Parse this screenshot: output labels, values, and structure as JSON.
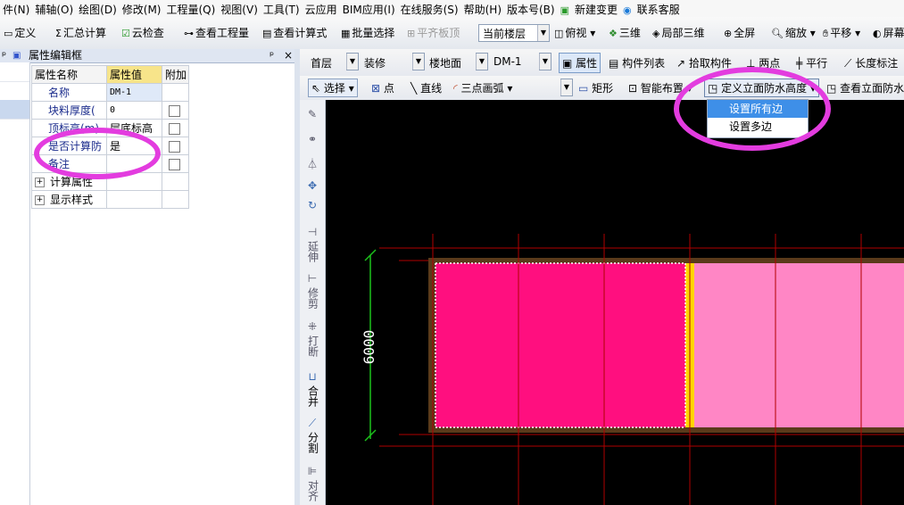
{
  "menubar": [
    "件(N)",
    "辅轴(O)",
    "绘图(D)",
    "修改(M)",
    "工程量(Q)",
    "视图(V)",
    "工具(T)",
    "云应用",
    "BIM应用(I)",
    "在线服务(S)",
    "帮助(H)",
    "版本号(B)",
    "新建变更",
    "联系客服"
  ],
  "toolbar1": {
    "define": "定义",
    "sum_calc": "汇总计算",
    "cloud_check": "云检查",
    "view_quantity": "查看工程量",
    "view_formula": "查看计算式",
    "batch_select": "批量选择",
    "align_slab": "平齐板顶",
    "floor_combo": "当前楼层",
    "top_view": "俯视",
    "three_d": "三维",
    "local_3d": "局部三维",
    "fullscreen": "全屏",
    "zoom": "缩放",
    "pan": "平移",
    "screen": "屏幕"
  },
  "panel": {
    "title": "属性编辑框",
    "pin": "ᵖ",
    "close": "×"
  },
  "prop_table": {
    "headers": [
      "属性名称",
      "属性值",
      "附加"
    ],
    "rows": [
      {
        "name": "名称",
        "value": "DM-1"
      },
      {
        "name": "块料厚度(",
        "value": "0"
      },
      {
        "name": "顶标高(m)",
        "value": "层底标高"
      },
      {
        "name": "是否计算防",
        "value": "是"
      },
      {
        "name": "备注",
        "value": ""
      }
    ],
    "groups": [
      "计算属性",
      "显示样式"
    ]
  },
  "toolbar2": {
    "floor": "首层",
    "category": "装修",
    "type": "楼地面",
    "component": "DM-1",
    "properties": "属性",
    "component_list": "构件列表",
    "pick": "拾取构件",
    "two_points": "两点",
    "parallel": "平行",
    "length_mark": "长度标注"
  },
  "toolbar3": {
    "select": "选择",
    "point": "点",
    "line": "直线",
    "arc": "三点画弧",
    "rect": "矩形",
    "smart": "智能布置",
    "define_height": "定义立面防水高度",
    "view_height": "查看立面防水"
  },
  "dropdown": [
    "设置所有边",
    "设置多边"
  ],
  "vtools": [
    "延伸",
    "修剪",
    "打断",
    "合并",
    "分割",
    "对齐"
  ],
  "dimension": "6000",
  "colors": {
    "magenta": "#ff0f7f",
    "pink": "#ff86c5",
    "annotation": "#e33cdf"
  }
}
